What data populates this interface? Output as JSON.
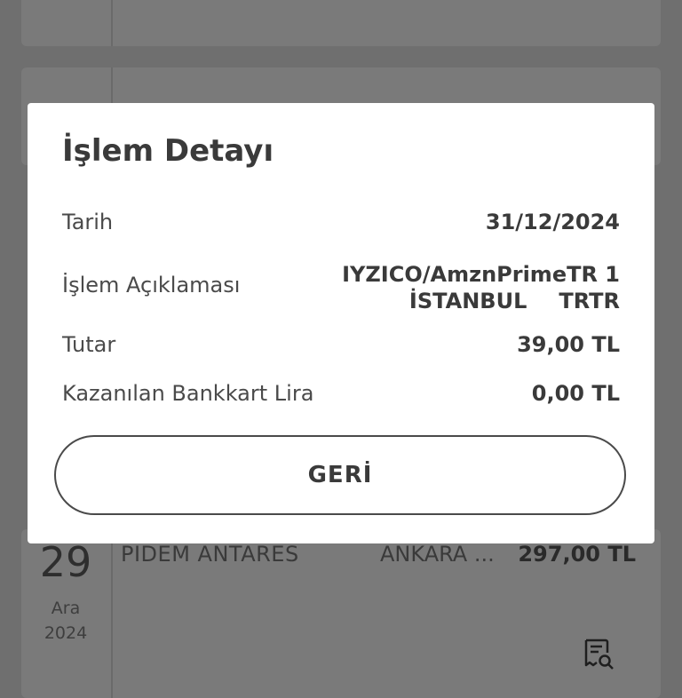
{
  "background": {
    "transactions": [
      {
        "day": "29",
        "month": "Ara",
        "year": "2024",
        "merchant": "PIDEM ANTARES",
        "city": "ANKARA ...",
        "amount": "297,00 TL"
      }
    ]
  },
  "modal": {
    "title": "İşlem Detayı",
    "rows": [
      {
        "label": "Tarih",
        "value": "31/12/2024"
      },
      {
        "label": "İşlem Açıklaması",
        "value_line1": "IYZICO/AmznPrimeTR 1",
        "value_line2a": "İSTANBUL",
        "value_line2b": "TRTR"
      },
      {
        "label": "Tutar",
        "value": "39,00 TL"
      },
      {
        "label": "Kazanılan Bankkart Lira",
        "value": "0,00 TL"
      }
    ],
    "back_label": "GERİ"
  }
}
